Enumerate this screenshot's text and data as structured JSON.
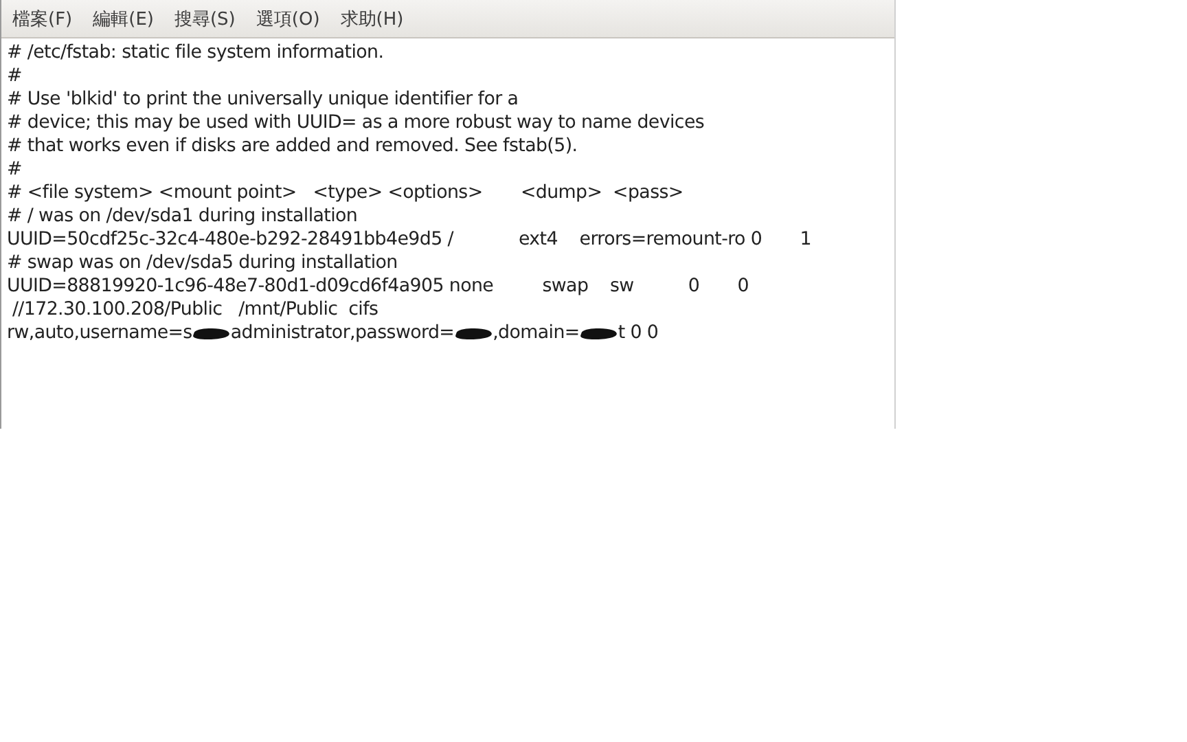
{
  "menu_bar": {
    "items": [
      "檔案(F)",
      "編輯(E)",
      "搜尋(S)",
      "選項(O)",
      "求助(H)"
    ]
  },
  "editor": {
    "lines": [
      {
        "kind": "text",
        "text": "# /etc/fstab: static file system information."
      },
      {
        "kind": "text",
        "text": "#"
      },
      {
        "kind": "text",
        "text": "# Use 'blkid' to print the universally unique identifier for a"
      },
      {
        "kind": "text",
        "text": "# device; this may be used with UUID= as a more robust way to name devices"
      },
      {
        "kind": "text",
        "text": "# that works even if disks are added and removed. See fstab(5)."
      },
      {
        "kind": "text",
        "text": "#"
      },
      {
        "kind": "text",
        "text": "# <file system> <mount point>   <type> <options>       <dump>  <pass>"
      },
      {
        "kind": "text",
        "text": "# / was on /dev/sda1 during installation"
      },
      {
        "kind": "text",
        "text": "UUID=50cdf25c-32c4-480e-b292-28491bb4e9d5 /            ext4    errors=remount-ro 0       1"
      },
      {
        "kind": "text",
        "text": "# swap was on /dev/sda5 during installation"
      },
      {
        "kind": "text",
        "text": "UUID=88819920-1c96-48e7-80d1-d09cd6f4a905 none         swap    sw          0       0"
      },
      {
        "kind": "text",
        "text": " //172.30.100.208/Public   /mnt/Public  cifs"
      },
      {
        "kind": "segments",
        "segments": [
          {
            "kind": "text",
            "text": "rw,auto,username=s"
          },
          {
            "kind": "redacted"
          },
          {
            "kind": "text",
            "text": "administrator,password="
          },
          {
            "kind": "redacted"
          },
          {
            "kind": "text",
            "text": ",domain="
          },
          {
            "kind": "redacted"
          },
          {
            "kind": "text",
            "text": "t 0 0"
          }
        ]
      }
    ]
  }
}
